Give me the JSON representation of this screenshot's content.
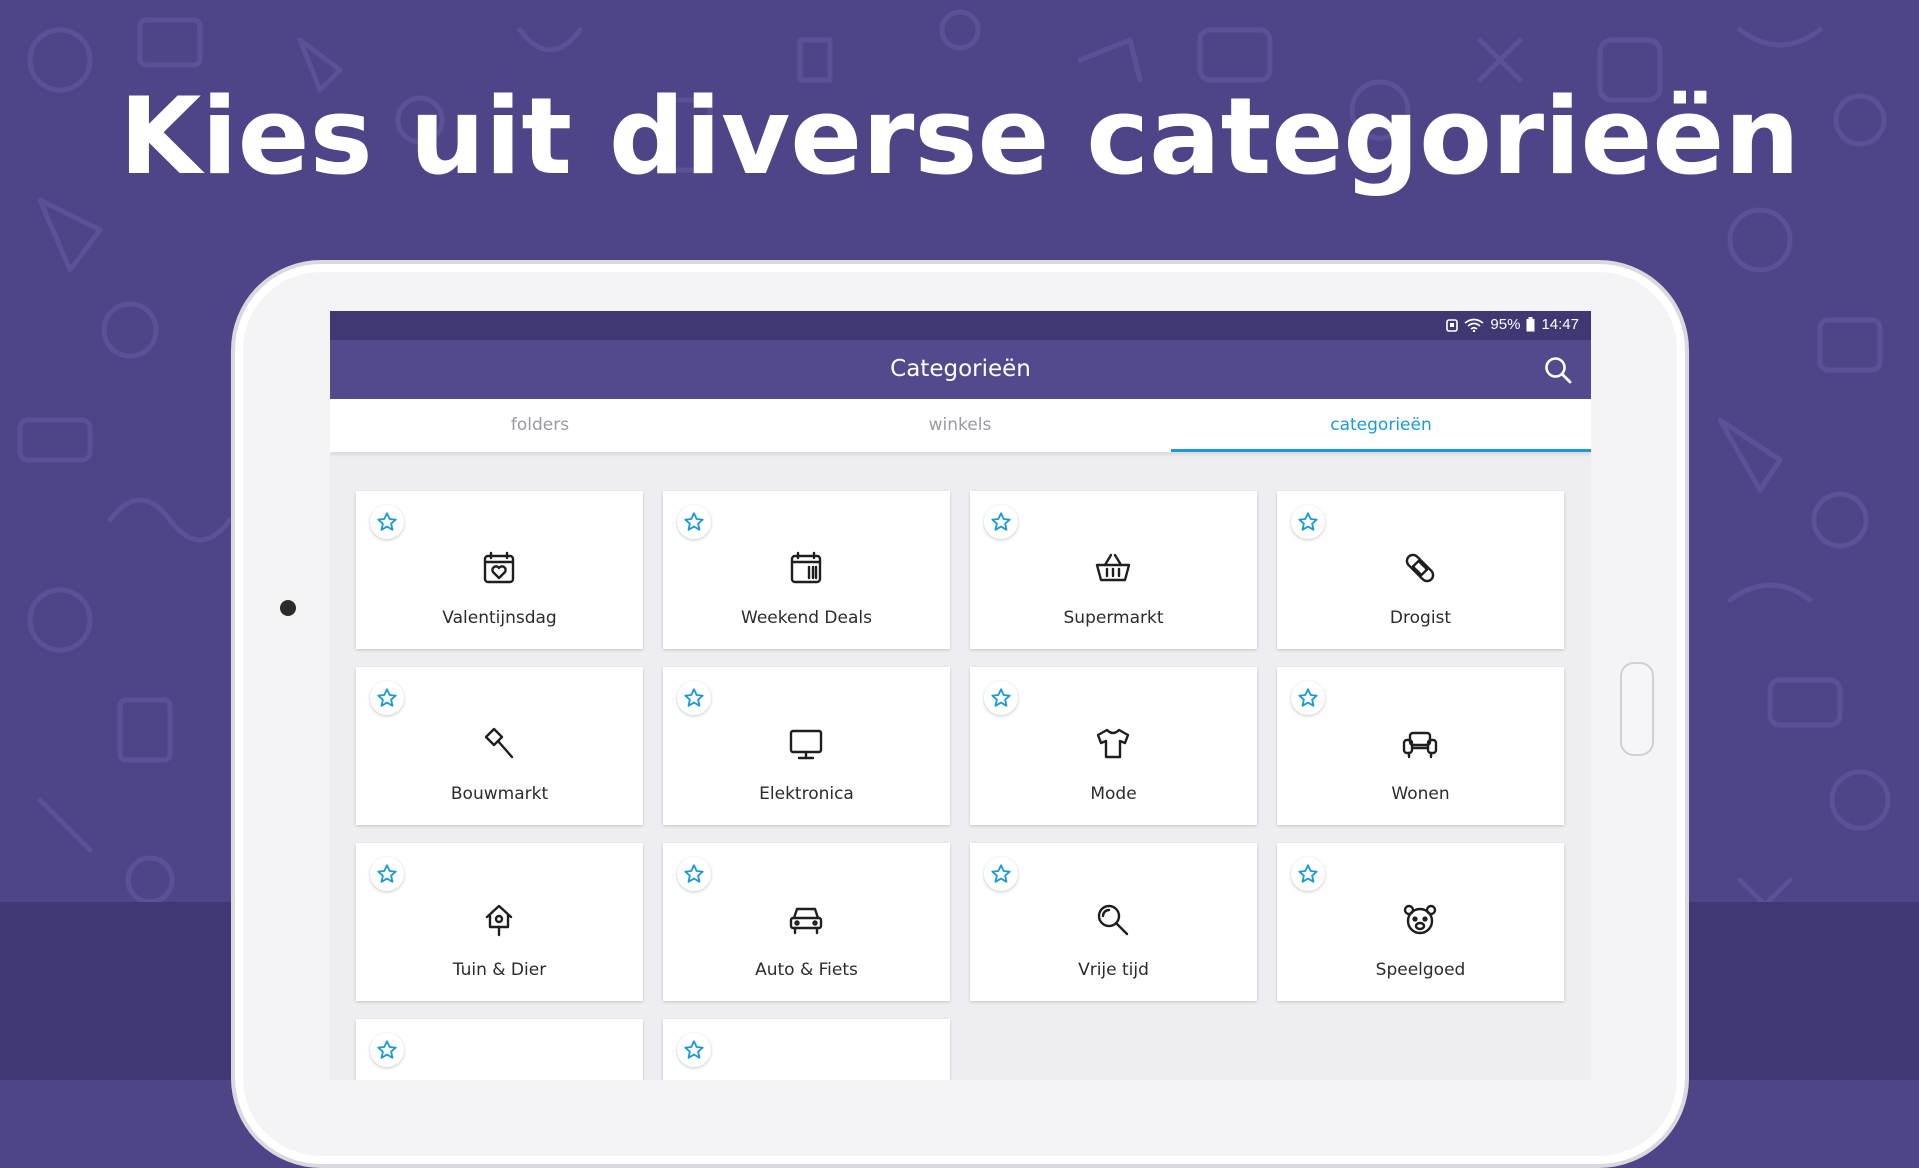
{
  "headline": "Kies uit diverse categorieën",
  "status_bar": {
    "battery_percent": "95%",
    "time": "14:47"
  },
  "app_bar": {
    "title": "Categorieën"
  },
  "tabs": [
    {
      "label": "folders",
      "active": false
    },
    {
      "label": "winkels",
      "active": false
    },
    {
      "label": "categorieën",
      "active": true
    }
  ],
  "categories": [
    {
      "label": "Valentijnsdag",
      "icon": "calendar-heart-icon"
    },
    {
      "label": "Weekend Deals",
      "icon": "calendar-icon"
    },
    {
      "label": "Supermarkt",
      "icon": "basket-icon"
    },
    {
      "label": "Drogist",
      "icon": "bandage-icon"
    },
    {
      "label": "Bouwmarkt",
      "icon": "hammer-icon"
    },
    {
      "label": "Elektronica",
      "icon": "monitor-icon"
    },
    {
      "label": "Mode",
      "icon": "shirt-icon"
    },
    {
      "label": "Wonen",
      "icon": "armchair-icon"
    },
    {
      "label": "Tuin & Dier",
      "icon": "birdhouse-icon"
    },
    {
      "label": "Auto & Fiets",
      "icon": "car-icon"
    },
    {
      "label": "Vrije tijd",
      "icon": "magnifier-icon"
    },
    {
      "label": "Speelgoed",
      "icon": "teddy-bear-icon"
    },
    {
      "label": "",
      "icon": ""
    },
    {
      "label": "",
      "icon": ""
    }
  ],
  "colors": {
    "background": "#4e4589",
    "app_bar": "#524a8d",
    "status_bar": "#3f3873",
    "accent": "#1a9ad6"
  }
}
